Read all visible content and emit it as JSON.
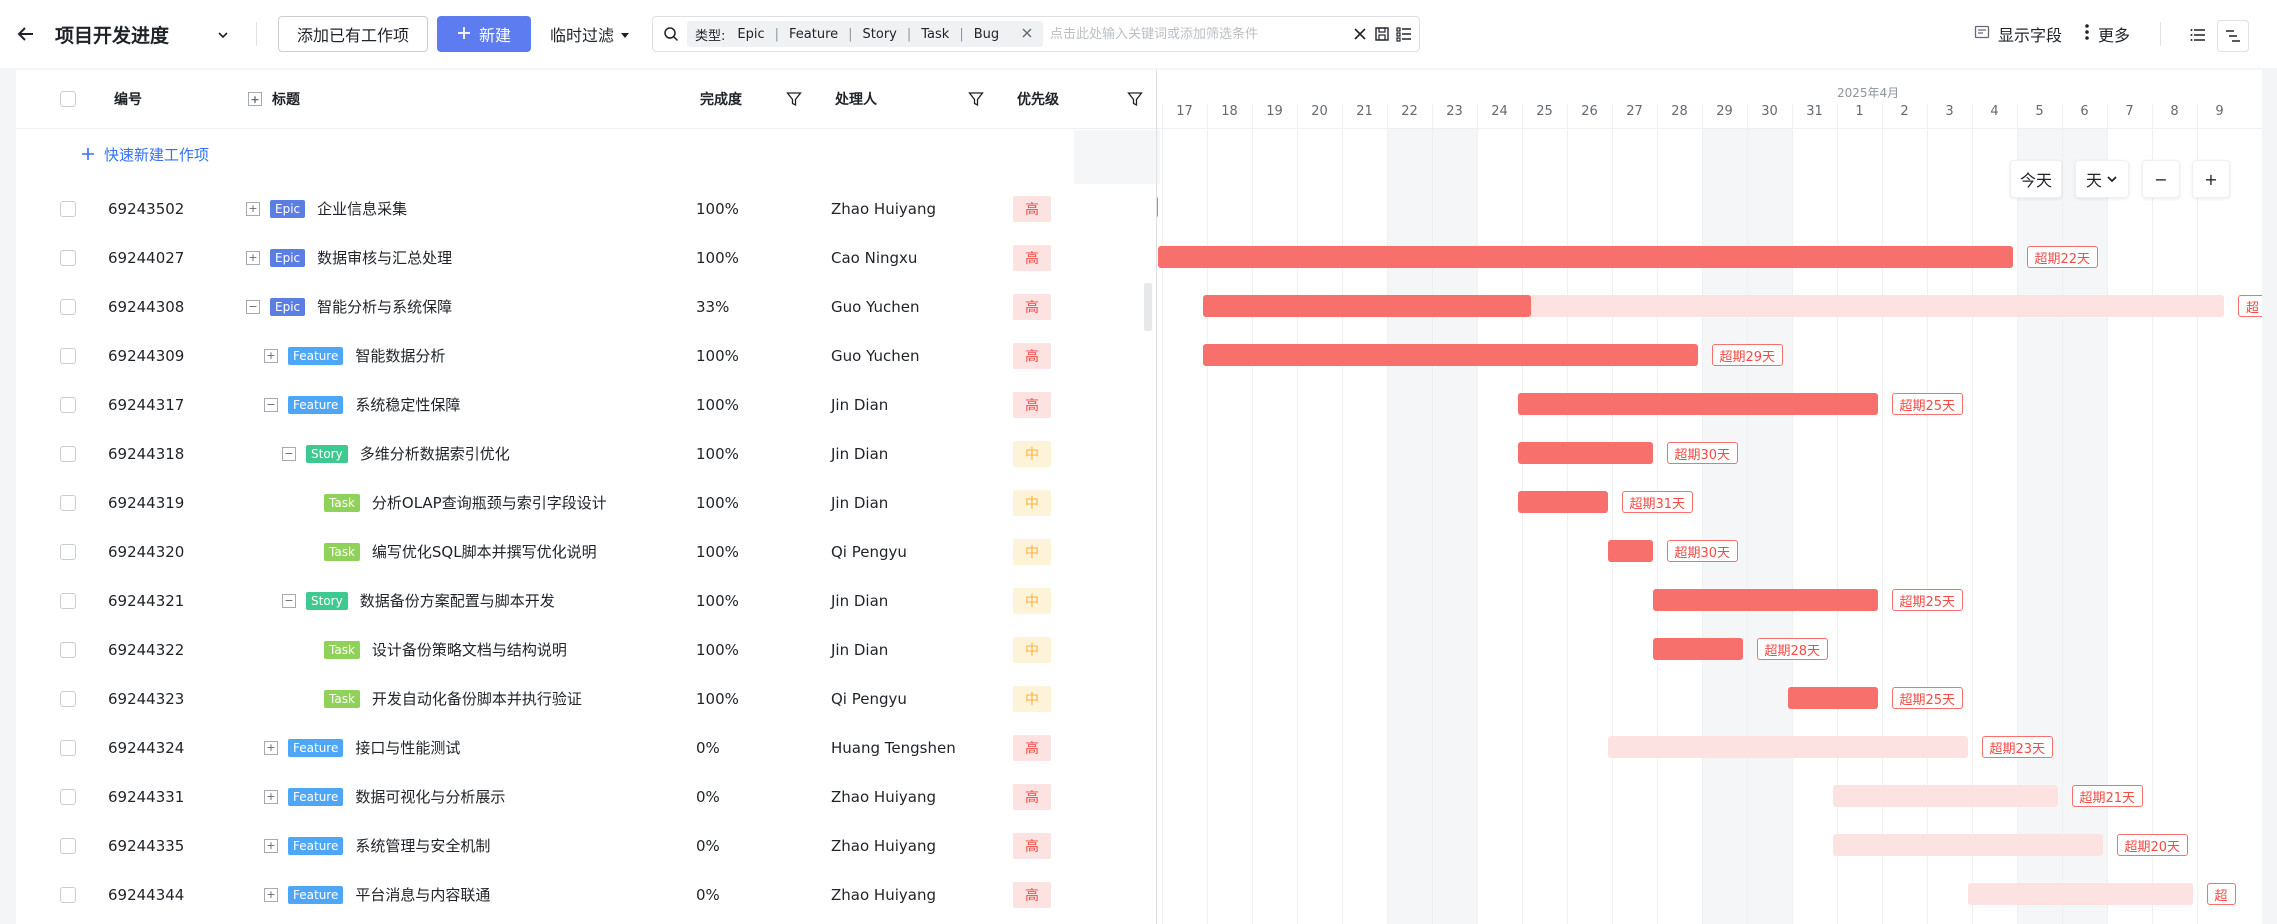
{
  "header": {
    "title": "项目开发进度",
    "add_existing_label": "添加已有工作项",
    "new_label": "新建",
    "temp_filter_label": "临时过滤",
    "search": {
      "type_label": "类型:",
      "types": [
        "Epic",
        "Feature",
        "Story",
        "Task",
        "Bug"
      ],
      "placeholder": "点击此处输入关键词或添加筛选条件"
    },
    "show_fields_label": "显示字段",
    "more_label": "更多"
  },
  "table": {
    "columns": {
      "id": "编号",
      "title": "标题",
      "progress": "完成度",
      "assignee": "处理人",
      "priority": "优先级"
    },
    "quick_create_label": "快速新建工作项",
    "rows": [
      {
        "id": "69243502",
        "type": "Epic",
        "title": "企业信息采集",
        "progress": "100%",
        "assignee": "Zhao Huiyang",
        "priority": "高",
        "level": 0,
        "expand": "+"
      },
      {
        "id": "69244027",
        "type": "Epic",
        "title": "数据审核与汇总处理",
        "progress": "100%",
        "assignee": "Cao Ningxu",
        "priority": "高",
        "level": 0,
        "expand": "+"
      },
      {
        "id": "69244308",
        "type": "Epic",
        "title": "智能分析与系统保障",
        "progress": "33%",
        "assignee": "Guo Yuchen",
        "priority": "高",
        "level": 0,
        "expand": "−"
      },
      {
        "id": "69244309",
        "type": "Feature",
        "title": "智能数据分析",
        "progress": "100%",
        "assignee": "Guo Yuchen",
        "priority": "高",
        "level": 1,
        "expand": "+"
      },
      {
        "id": "69244317",
        "type": "Feature",
        "title": "系统稳定性保障",
        "progress": "100%",
        "assignee": "Jin Dian",
        "priority": "高",
        "level": 1,
        "expand": "−"
      },
      {
        "id": "69244318",
        "type": "Story",
        "title": "多维分析数据索引优化",
        "progress": "100%",
        "assignee": "Jin Dian",
        "priority": "中",
        "level": 2,
        "expand": "−"
      },
      {
        "id": "69244319",
        "type": "Task",
        "title": "分析OLAP查询瓶颈与索引字段设计",
        "progress": "100%",
        "assignee": "Jin Dian",
        "priority": "中",
        "level": 3,
        "expand": ""
      },
      {
        "id": "69244320",
        "type": "Task",
        "title": "编写优化SQL脚本并撰写优化说明",
        "progress": "100%",
        "assignee": "Qi Pengyu",
        "priority": "中",
        "level": 3,
        "expand": ""
      },
      {
        "id": "69244321",
        "type": "Story",
        "title": "数据备份方案配置与脚本开发",
        "progress": "100%",
        "assignee": "Jin Dian",
        "priority": "中",
        "level": 2,
        "expand": "−"
      },
      {
        "id": "69244322",
        "type": "Task",
        "title": "设计备份策略文档与结构说明",
        "progress": "100%",
        "assignee": "Jin Dian",
        "priority": "中",
        "level": 3,
        "expand": ""
      },
      {
        "id": "69244323",
        "type": "Task",
        "title": "开发自动化备份脚本并执行验证",
        "progress": "100%",
        "assignee": "Qi Pengyu",
        "priority": "中",
        "level": 3,
        "expand": ""
      },
      {
        "id": "69244324",
        "type": "Feature",
        "title": "接口与性能测试",
        "progress": "0%",
        "assignee": "Huang Tengshen",
        "priority": "高",
        "level": 1,
        "expand": "+"
      },
      {
        "id": "69244331",
        "type": "Feature",
        "title": "数据可视化与分析展示",
        "progress": "0%",
        "assignee": "Zhao Huiyang",
        "priority": "高",
        "level": 1,
        "expand": "+"
      },
      {
        "id": "69244335",
        "type": "Feature",
        "title": "系统管理与安全机制",
        "progress": "0%",
        "assignee": "Zhao Huiyang",
        "priority": "高",
        "level": 1,
        "expand": "+"
      },
      {
        "id": "69244344",
        "type": "Feature",
        "title": "平台消息与内容联通",
        "progress": "0%",
        "assignee": "Zhao Huiyang",
        "priority": "高",
        "level": 1,
        "expand": "+"
      }
    ]
  },
  "gantt": {
    "month_label": "2025年4月",
    "days": [
      "17",
      "18",
      "19",
      "20",
      "21",
      "22",
      "23",
      "24",
      "25",
      "26",
      "27",
      "28",
      "29",
      "30",
      "31",
      "1",
      "2",
      "3",
      "4",
      "5",
      "6",
      "7",
      "8",
      "9"
    ],
    "weekend_day_index_pairs": [
      [
        5,
        6
      ],
      [
        12,
        13
      ],
      [
        19,
        20
      ]
    ],
    "today_label": "今天",
    "scale_label": "天",
    "zoom_out": "−",
    "zoom_in": "+",
    "bars": [
      {
        "row": 0,
        "start_day": -0.1,
        "done_end_day": -0.1,
        "end_day": -0.1,
        "overdue": ""
      },
      {
        "row": 1,
        "start_day": -0.1,
        "done_end_day": 18.9,
        "end_day": 18.9,
        "overdue": "超期22天"
      },
      {
        "row": 2,
        "start_day": 0.9,
        "done_end_day": 8.2,
        "end_day": 23.6,
        "overdue": "超"
      },
      {
        "row": 3,
        "start_day": 0.9,
        "done_end_day": 11.9,
        "end_day": 11.9,
        "overdue": "超期29天"
      },
      {
        "row": 4,
        "start_day": 7.9,
        "done_end_day": 15.9,
        "end_day": 15.9,
        "overdue": "超期25天"
      },
      {
        "row": 5,
        "start_day": 7.9,
        "done_end_day": 10.9,
        "end_day": 10.9,
        "overdue": "超期30天"
      },
      {
        "row": 6,
        "start_day": 7.9,
        "done_end_day": 9.9,
        "end_day": 9.9,
        "overdue": "超期31天"
      },
      {
        "row": 7,
        "start_day": 9.9,
        "done_end_day": 10.9,
        "end_day": 10.9,
        "overdue": "超期30天"
      },
      {
        "row": 8,
        "start_day": 10.9,
        "done_end_day": 15.9,
        "end_day": 15.9,
        "overdue": "超期25天"
      },
      {
        "row": 9,
        "start_day": 10.9,
        "done_end_day": 12.9,
        "end_day": 12.9,
        "overdue": "超期28天"
      },
      {
        "row": 10,
        "start_day": 13.9,
        "done_end_day": 15.9,
        "end_day": 15.9,
        "overdue": "超期25天"
      },
      {
        "row": 11,
        "start_day": 9.9,
        "done_end_day": 9.9,
        "end_day": 17.9,
        "overdue": "超期23天"
      },
      {
        "row": 12,
        "start_day": 14.9,
        "done_end_day": 14.9,
        "end_day": 19.9,
        "overdue": "超期21天"
      },
      {
        "row": 13,
        "start_day": 14.9,
        "done_end_day": 14.9,
        "end_day": 20.9,
        "overdue": "超期20天"
      },
      {
        "row": 14,
        "start_day": 17.9,
        "done_end_day": 17.9,
        "end_day": 22.9,
        "overdue": "超"
      }
    ]
  },
  "colors": {
    "accent": "#3370ff",
    "primary_button": "#5c7cf0",
    "bar_done": "#f7706c",
    "bar_plan": "#fde2e2",
    "epic": "#5b7ee5",
    "feature": "#4ea6f7",
    "story": "#3dc98f",
    "task": "#8fd159"
  },
  "icons": {
    "back": "arrow-left-icon",
    "title_dropdown": "chevron-down-icon",
    "new": "plus-icon",
    "search": "search-icon",
    "clear": "close-icon",
    "save_view": "save-icon",
    "list_settings": "list-check-icon",
    "show_fields": "fields-icon",
    "more": "more-vertical-icon",
    "list_view": "list-icon",
    "gantt_view": "gantt-icon"
  }
}
